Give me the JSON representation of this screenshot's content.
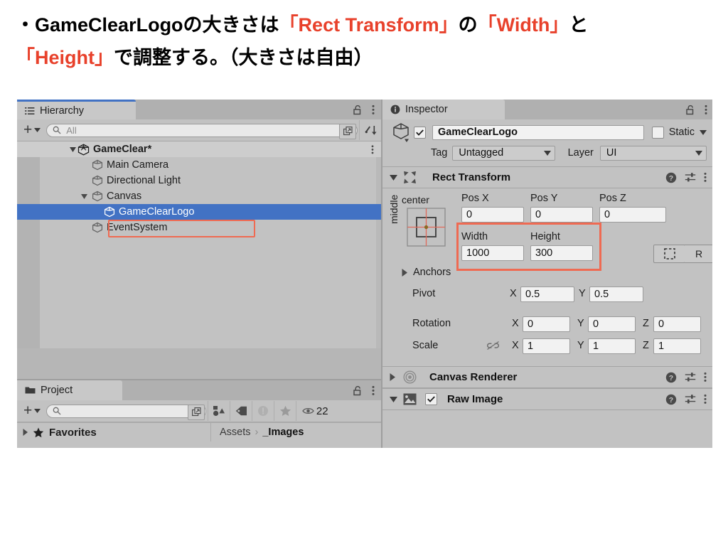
{
  "caption": {
    "line1_a": "・GameClearLogoの大きさは",
    "line1_red1": "「Rect Transform」",
    "line1_b": "の",
    "line1_red2": "「Width」",
    "line1_c": "と",
    "line2_red": "「Height」",
    "line2_b": "で調整する。（大きさは自由）"
  },
  "colors": {
    "accent_red": "#e8412b",
    "highlight_box": "#ef6a52",
    "selection_blue": "#4272c4",
    "panel_bg": "#c2c2c2"
  },
  "hierarchy": {
    "tab_label": "Hierarchy",
    "tab_icon": "list-icon",
    "lock_icon": "lock-open-icon",
    "menu_icon": "kebab-menu-icon",
    "add_label": "+",
    "search_placeholder": "All",
    "search_value": "",
    "tree": [
      {
        "label": "GameClear*",
        "depth": 0,
        "expanded": true,
        "scene": true,
        "selected": false
      },
      {
        "label": "Main Camera",
        "depth": 2,
        "expanded": null,
        "scene": false,
        "selected": false
      },
      {
        "label": "Directional Light",
        "depth": 2,
        "expanded": null,
        "scene": false,
        "selected": false
      },
      {
        "label": "Canvas",
        "depth": 1,
        "expanded": true,
        "scene": false,
        "selected": false
      },
      {
        "label": "GameClearLogo",
        "depth": 2,
        "expanded": null,
        "scene": false,
        "selected": true
      },
      {
        "label": "EventSystem",
        "depth": 2,
        "expanded": null,
        "scene": false,
        "selected": false
      }
    ]
  },
  "project": {
    "tab_label": "Project",
    "tab_icon": "folder-icon",
    "lock_icon": "lock-open-icon",
    "menu_icon": "kebab-menu-icon",
    "add_label": "+",
    "search_placeholder": "",
    "search_value": "",
    "toolbar_icons": [
      "asset-filter-icon",
      "label-tag-icon",
      "warning-icon",
      "favorite-star-icon",
      "visibility-eye-icon"
    ],
    "visible_count": "22",
    "favorites_label": "Favorites",
    "breadcrumb_root": "Assets",
    "breadcrumb_sep": "›",
    "breadcrumb_current": "_Images"
  },
  "inspector": {
    "tab_label": "Inspector",
    "tab_icon": "info-icon",
    "lock_icon": "lock-open-icon",
    "menu_icon": "kebab-menu-icon",
    "object": {
      "icon": "gameobject-cube-icon",
      "enabled": true,
      "name": "GameClearLogo",
      "static_label": "Static",
      "static_checked": false,
      "tag_label": "Tag",
      "tag_value": "Untagged",
      "layer_label": "Layer",
      "layer_value": "UI"
    },
    "components": [
      {
        "name": "Rect Transform",
        "icon": "rect-transform-icon",
        "expanded": true,
        "help_icon": "help-icon",
        "preset_icon": "preset-sliders-icon",
        "menu_icon": "kebab-menu-icon"
      },
      {
        "name": "Canvas Renderer",
        "icon": "canvas-renderer-icon",
        "expanded": false,
        "help_icon": "help-icon",
        "preset_icon": "preset-sliders-icon",
        "menu_icon": "kebab-menu-icon"
      },
      {
        "name": "Raw Image",
        "icon": "raw-image-icon",
        "expanded": true,
        "enabled": true,
        "help_icon": "help-icon",
        "preset_icon": "preset-sliders-icon",
        "menu_icon": "kebab-menu-icon"
      }
    ],
    "rect_transform": {
      "anchor_preset_top": "center",
      "anchor_preset_side": "middle",
      "pos_x_label": "Pos X",
      "pos_x_value": "0",
      "pos_y_label": "Pos Y",
      "pos_y_value": "0",
      "pos_z_label": "Pos Z",
      "pos_z_value": "0",
      "width_label": "Width",
      "width_value": "1000",
      "height_label": "Height",
      "height_value": "300",
      "blueprint_button": "blueprint-mode-icon",
      "raw_edit_button": "R",
      "anchors_label": "Anchors",
      "pivot_label": "Pivot",
      "pivot_x_axis": "X",
      "pivot_x_value": "0.5",
      "pivot_y_axis": "Y",
      "pivot_y_value": "0.5",
      "rotation_label": "Rotation",
      "rotation_x_axis": "X",
      "rotation_x_value": "0",
      "rotation_y_axis": "Y",
      "rotation_y_value": "0",
      "rotation_z_axis": "Z",
      "rotation_z_value": "0",
      "scale_label": "Scale",
      "scale_link_icon": "link-broken-icon",
      "scale_x_axis": "X",
      "scale_x_value": "1",
      "scale_y_axis": "Y",
      "scale_y_value": "1",
      "scale_z_axis": "Z",
      "scale_z_value": "1"
    }
  }
}
